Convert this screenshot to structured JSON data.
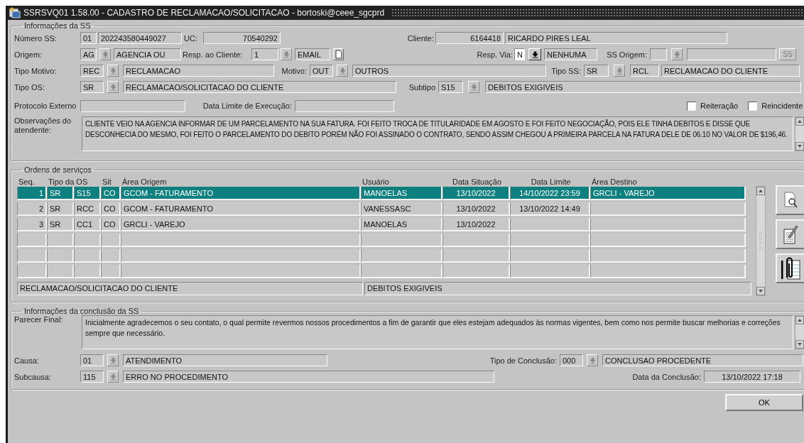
{
  "window": {
    "title": "SSRSVQ01 1.58.00 - CADASTRO DE RECLAMACAO/SOLICITACAO - bortoski@ceee_sgcprd"
  },
  "info": {
    "title": "Informações da SS",
    "numero_ss": {
      "label": "Número SS:",
      "prefix": "01",
      "number": "202243580449027"
    },
    "uc": {
      "label": "UC:",
      "value": "70540292"
    },
    "cliente": {
      "label": "Cliente:",
      "code": "6164418",
      "name": "RICARDO PIRES LEAL"
    },
    "origem": {
      "label": "Origem:",
      "code": "AG",
      "description": "AGENCIA OU",
      "lov_enabled": false
    },
    "resp_cliente": {
      "label": "Resp. ao Cliente:",
      "code": "1",
      "description": "EMAIL",
      "lov_enabled": false
    },
    "resp_via": {
      "label": "Resp. Via:",
      "code": "N",
      "description": "NENHUMA",
      "lov_enabled": true
    },
    "ss_origem": {
      "label": "SS Origem:",
      "button": "SS",
      "lov_enabled": false
    },
    "tipo_motivo": {
      "label": "Tipo Motivo:",
      "code": "REC",
      "description": "RECLAMACAO",
      "lov_enabled": false
    },
    "motivo": {
      "label": "Motivo:",
      "code": "OUT",
      "description": "OUTROS",
      "lov_enabled": false
    },
    "tipo_ss": {
      "label": "Tipo SS:",
      "code": "SR",
      "subcode": "RCL",
      "description": "RECLAMACAO DO CLIENTE",
      "lov_enabled": false
    },
    "tipo_os": {
      "label": "Tipo OS:",
      "code": "SR",
      "description": "RECLAMACAO/SOLICITACAO DO CLIENTE",
      "lov_enabled": false
    },
    "subtipo": {
      "label": "Subtipo",
      "code": "S15",
      "description": "DEBITOS EXIGIVEIS",
      "lov_enabled": false
    },
    "protocolo": {
      "label": "Protocolo Externo"
    },
    "data_limite": {
      "label": "Data Limite de Execução:"
    },
    "checkboxes": [
      {
        "label": "Reiteração",
        "checked": false
      },
      {
        "label": "Reincidente",
        "checked": false
      }
    ],
    "observacoes": {
      "label": "Observações do atendente:",
      "value": "CLIENTE VEIO NA AGENCIA INFORMAR DE UM PARCELAMENTO NA SUA FATURA. FOI FEITO TROCA DE TITULARIDADE EM AGOSTO E FOI FEITO NEGOCIAÇÃO, POIS ELE TINHA DEBITOS E DISSE QUE DESCONHECIA DO MESMO, FOI FEITO O PARCELAMENTO DO DEBITO PORÉM NÃO FOI ASSINADO O CONTRATO, SENDO ASSIM CHEGOU A PRIMEIRA PARCELA NA FATURA DELE DE 06.10 NO VALOR DE $196,46."
    }
  },
  "orders": {
    "title": "Ordens de serviços",
    "columns": [
      "Seq.",
      "Tipo da OS",
      "Sit",
      "Área Origem",
      "Usuário",
      "Data Situação",
      "Data Limite",
      "Área Destino"
    ],
    "rows": [
      {
        "seq": "1",
        "tipo": "SR",
        "subtipo": "S15",
        "sit": "CO",
        "area_origem": "GCOM - FATURAMENTO",
        "usuario": "MANOELAS",
        "data_situacao": "13/10/2022",
        "data_limite": "14/10/2022 23:59",
        "area_destino": "GRCLI - VAREJO",
        "selected": true
      },
      {
        "seq": "2",
        "tipo": "SR",
        "subtipo": "RCC",
        "sit": "CO",
        "area_origem": "GCOM - FATURAMENTO",
        "usuario": "VANESSASC",
        "data_situacao": "13/10/2022",
        "data_limite": "13/10/2022 14:49",
        "selected": false
      },
      {
        "seq": "3",
        "tipo": "SR",
        "subtipo": "CC1",
        "sit": "CO",
        "area_origem": "GRCLI - VAREJO",
        "usuario": "MANOELAS",
        "data_situacao": "13/10/2022",
        "selected": false
      }
    ],
    "footer": [
      "RECLAMACAO/SOLICITACAO DO CLIENTE",
      "DEBITOS EXIGIVEIS"
    ]
  },
  "conclusion": {
    "title": "Informações da conclusão da SS",
    "parecer": {
      "label": "Parecer Final:",
      "value": "Inicialmente agradecemos o seu contato, o qual permite revermos nossos procedimentos a fim de garantir que eles estejam adequados às normas vigentes, bem como nos permite buscar melhorias e correções sempre que necessário."
    },
    "causa": {
      "label": "Causa:",
      "code": "01",
      "description": "ATENDIMENTO",
      "lov_enabled": false
    },
    "tipo_conclusao": {
      "label": "Tipo de Conclusão:",
      "code": "000",
      "description": "CONCLUSAO PROCEDENTE",
      "lov_enabled": false
    },
    "subcausa": {
      "label": "Subcausa:",
      "code": "115",
      "description": "ERRO NO PROCEDIMENTO",
      "lov_enabled": false
    },
    "data_conclusao": {
      "label": "Data da Conclusão:",
      "value": "13/10/2022 17:18"
    }
  },
  "buttons": {
    "ok": "OK"
  }
}
